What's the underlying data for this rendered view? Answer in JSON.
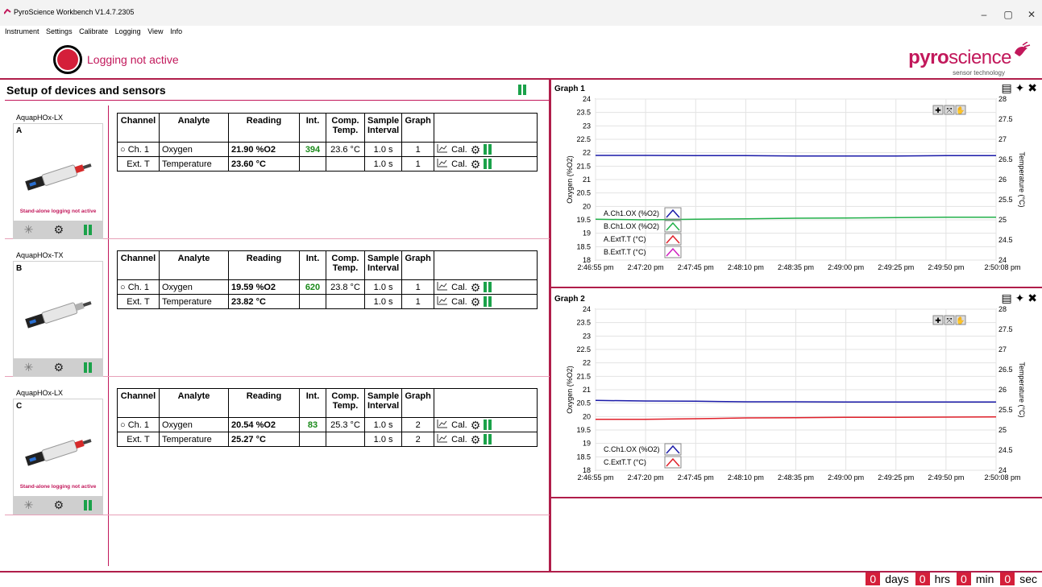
{
  "window": {
    "title": "PyroScience Workbench V1.4.7.2305",
    "minimize": "–",
    "maximize": "▢",
    "close": "✕"
  },
  "menu": [
    "Instrument",
    "Settings",
    "Calibrate",
    "Logging",
    "View",
    "Info"
  ],
  "logging_status": "Logging not active",
  "brand": {
    "name_bold": "pyro",
    "name_rest": "science",
    "tagline": "sensor technology"
  },
  "setup_title": "Setup of devices and sensors",
  "table_headers": [
    "Channel",
    "Analyte",
    "Reading",
    "Int.",
    "Comp. Temp.",
    "Sample Interval",
    "Graph"
  ],
  "cal_label": "Cal.",
  "devices": [
    {
      "model": "AquapHOx-LX",
      "letter": "A",
      "standalone": "Stand-alone logging not active",
      "rows": [
        {
          "channel": "Ch. 1",
          "analyte": "Oxygen",
          "reading": "21.90 %O2",
          "int": "394",
          "comp_temp": "23.6 °C",
          "interval": "1.0 s",
          "graph": "1"
        },
        {
          "channel": "Ext. T",
          "analyte": "Temperature",
          "reading": "23.60 °C",
          "int": "",
          "comp_temp": "",
          "interval": "1.0 s",
          "graph": "1"
        }
      ]
    },
    {
      "model": "AquapHOx-TX",
      "letter": "B",
      "standalone": "",
      "rows": [
        {
          "channel": "Ch. 1",
          "analyte": "Oxygen",
          "reading": "19.59 %O2",
          "int": "620",
          "comp_temp": "23.8 °C",
          "interval": "1.0 s",
          "graph": "1"
        },
        {
          "channel": "Ext. T",
          "analyte": "Temperature",
          "reading": "23.82 °C",
          "int": "",
          "comp_temp": "",
          "interval": "1.0 s",
          "graph": "1"
        }
      ]
    },
    {
      "model": "AquapHOx-LX",
      "letter": "C",
      "standalone": "Stand-alone logging not active",
      "rows": [
        {
          "channel": "Ch. 1",
          "analyte": "Oxygen",
          "reading": "20.54 %O2",
          "int": "83",
          "comp_temp": "25.3 °C",
          "interval": "1.0 s",
          "graph": "2"
        },
        {
          "channel": "Ext. T",
          "analyte": "Temperature",
          "reading": "25.27 °C",
          "int": "",
          "comp_temp": "",
          "interval": "1.0 s",
          "graph": "2"
        }
      ]
    }
  ],
  "colors": {
    "accent": "#c2185b",
    "record_red": "#d41f3a",
    "pause_green": "#1ba24a"
  },
  "chart_data": [
    {
      "type": "line",
      "title": "Graph 1",
      "ylabel": "Oxygen (%O2)",
      "y2label": "Temperature (°C)",
      "ylim": [
        18,
        24
      ],
      "y2lim": [
        24,
        28
      ],
      "yticks": [
        "18",
        "18.5",
        "19",
        "19.5",
        "20",
        "20.5",
        "21",
        "21.5",
        "22",
        "22.5",
        "23",
        "23.5",
        "24"
      ],
      "y2ticks": [
        "24",
        "24.5",
        "25",
        "25.5",
        "26",
        "26.5",
        "27",
        "27.5",
        "28"
      ],
      "x": [
        "2:46:55 pm",
        "2:47:20 pm",
        "2:47:45 pm",
        "2:48:10 pm",
        "2:48:35 pm",
        "2:49:00 pm",
        "2:49:25 pm",
        "2:49:50 pm",
        "2:50:08 pm"
      ],
      "series": [
        {
          "name": "A.Ch1.OX (%O2)",
          "color": "#1a1aa8",
          "values": [
            21.9,
            21.9,
            21.89,
            21.89,
            21.88,
            21.88,
            21.88,
            21.89,
            21.89
          ]
        },
        {
          "name": "B.Ch1.OX (%O2)",
          "color": "#22b04a",
          "values": [
            19.52,
            19.5,
            19.52,
            19.54,
            19.56,
            19.57,
            19.58,
            19.6,
            19.6
          ]
        },
        {
          "name": "A.ExtT.T (°C)",
          "color": "#e0202a",
          "values": []
        },
        {
          "name": "B.ExtT.T (°C)",
          "color": "#d020c0",
          "values": []
        }
      ]
    },
    {
      "type": "line",
      "title": "Graph 2",
      "ylabel": "Oxygen (%O2)",
      "y2label": "Temperature (°C)",
      "ylim": [
        18,
        24
      ],
      "y2lim": [
        24,
        28
      ],
      "yticks": [
        "18",
        "18.5",
        "19",
        "19.5",
        "20",
        "20.5",
        "21",
        "21.5",
        "22",
        "22.5",
        "23",
        "23.5",
        "24"
      ],
      "y2ticks": [
        "24",
        "24.5",
        "25",
        "25.5",
        "26",
        "26.5",
        "27",
        "27.5",
        "28"
      ],
      "x": [
        "2:46:55 pm",
        "2:47:20 pm",
        "2:47:45 pm",
        "2:48:10 pm",
        "2:48:35 pm",
        "2:49:00 pm",
        "2:49:25 pm",
        "2:49:50 pm",
        "2:50:08 pm"
      ],
      "series": [
        {
          "name": "C.Ch1.OX (%O2)",
          "color": "#1a1aa8",
          "values": [
            20.6,
            20.58,
            20.57,
            20.55,
            20.55,
            20.54,
            20.54,
            20.54,
            20.54
          ]
        },
        {
          "name": "C.ExtT.T (°C)",
          "color": "#e0202a",
          "values": [
            19.9,
            19.9,
            19.92,
            19.95,
            19.96,
            19.97,
            19.97,
            19.98,
            19.99
          ]
        }
      ]
    }
  ],
  "timer": {
    "days": "0",
    "days_label": "days",
    "hrs": "0",
    "hrs_label": "hrs",
    "min": "0",
    "min_label": "min",
    "sec": "0",
    "sec_label": "sec"
  }
}
